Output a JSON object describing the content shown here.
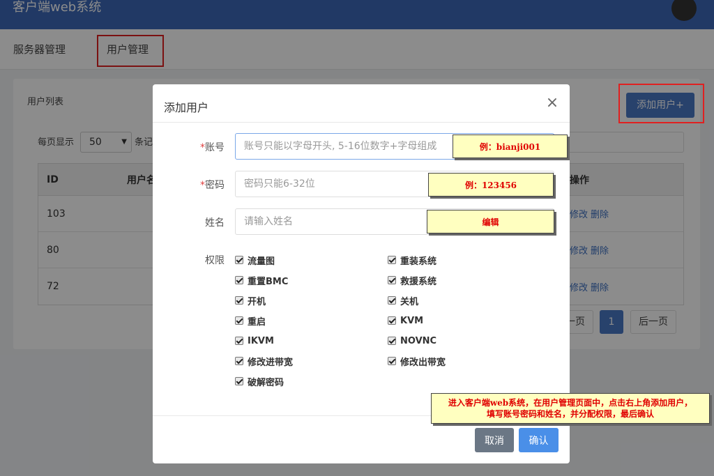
{
  "header": {
    "app_title": "客户端web系统"
  },
  "nav": {
    "items": [
      "服务器管理",
      "用户管理"
    ]
  },
  "panel": {
    "title": "用户列表",
    "add_user_label": "添加用户+",
    "per_page_prefix": "每页显示",
    "per_page_value": "50",
    "per_page_suffix": "条记",
    "columns": {
      "id": "ID",
      "name": "用户名",
      "ops": "操作"
    },
    "rows": [
      {
        "id": "103",
        "edit": "修改",
        "delete": "删除"
      },
      {
        "id": "80",
        "edit": "修改",
        "delete": "删除"
      },
      {
        "id": "72",
        "edit": "修改",
        "delete": "删除"
      }
    ],
    "pager": {
      "prev": "一页",
      "current": "1",
      "next": "后一页"
    }
  },
  "modal": {
    "title": "添加用户",
    "close": "×",
    "account": {
      "required": "*",
      "label": "账号",
      "placeholder": "账号只能以字母开头, 5-16位数字+字母组成"
    },
    "password": {
      "required": "*",
      "label": "密码",
      "placeholder": "密码只能6-32位"
    },
    "fullname": {
      "label": "姓名",
      "placeholder": "请输入姓名"
    },
    "permissions_label": "权限",
    "permissions_left": [
      "流量图",
      "重置BMC",
      "开机",
      "重启",
      "IKVM",
      "修改进带宽",
      "破解密码"
    ],
    "permissions_right": [
      "重装系统",
      "救援系统",
      "关机",
      "KVM",
      "NOVNC",
      "修改出带宽"
    ],
    "cancel_label": "取消",
    "confirm_label": "确认"
  },
  "notes": {
    "account_example": "例：bianji001",
    "password_example": "例：123456",
    "name_note": "编辑",
    "instructions_line1": "进入客户端web系统，在用户管理页面中，点击右上角添加用户，",
    "instructions_line2": "填写账号密码和姓名，并分配权限，最后确认"
  },
  "colors": {
    "header": "#3c68b8",
    "primary": "#4a78c5",
    "highlight": "#e02020",
    "note_bg": "#ffffc0",
    "note_text": "#e00000"
  }
}
